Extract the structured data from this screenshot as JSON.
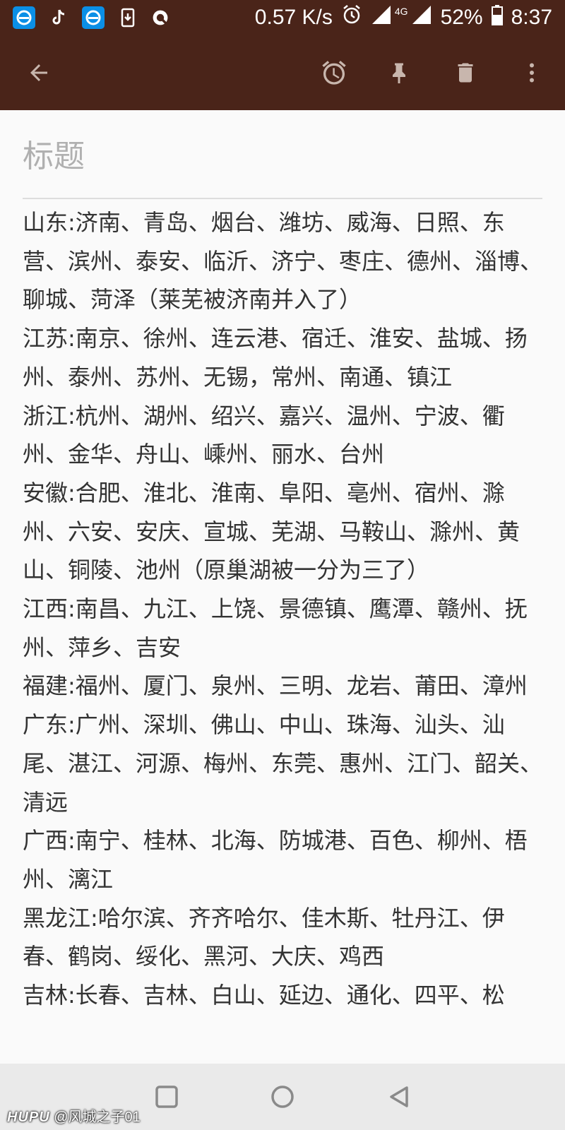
{
  "status_bar": {
    "net_speed": "0.57 K/s",
    "network": "4G",
    "battery": "52%",
    "time": "8:37",
    "icons": [
      "browser-app-icon",
      "tiktok-icon",
      "browser-app-icon",
      "download-icon",
      "q-app-icon",
      "alarm-icon",
      "signal-icon",
      "battery-icon"
    ]
  },
  "toolbar": {
    "icons": [
      "back-arrow-icon",
      "alarm-reminder-icon",
      "pin-icon",
      "delete-icon",
      "more-vert-icon"
    ],
    "color": "#4a2419"
  },
  "note": {
    "title_placeholder": "标题",
    "lines": [
      "山东:济南、青岛、烟台、潍坊、威海、日照、东营、滨州、泰安、临沂、济宁、枣庄、德州、淄博、聊城、菏泽（莱芜被济南并入了）",
      "江苏:南京、徐州、连云港、宿迁、淮安、盐城、扬州、泰州、苏州、无锡，常州、南通、镇江",
      "浙江:杭州、湖州、绍兴、嘉兴、温州、宁波、衢州、金华、舟山、嵊州、丽水、台州",
      "安徽:合肥、淮北、淮南、阜阳、亳州、宿州、滁州、六安、安庆、宣城、芜湖、马鞍山、滁州、黄山、铜陵、池州（原巢湖被一分为三了）",
      "江西:南昌、九江、上饶、景德镇、鹰潭、赣州、抚州、萍乡、吉安",
      "福建:福州、厦门、泉州、三明、龙岩、莆田、漳州",
      "广东:广州、深圳、佛山、中山、珠海、汕头、汕尾、湛江、河源、梅州、东莞、惠州、江门、韶关、清远",
      "广西:南宁、桂林、北海、防城港、百色、柳州、梧州、漓江",
      "黑龙江:哈尔滨、齐齐哈尔、佳木斯、牡丹江、伊春、鹤岗、绥化、黑河、大庆、鸡西",
      "吉林:长春、吉林、白山、延边、通化、四平、松"
    ]
  },
  "nav_bar": {
    "icons": [
      "recents-square-icon",
      "home-circle-icon",
      "back-triangle-icon"
    ]
  },
  "watermark": {
    "brand": "HUPU",
    "user": "@风城之子01"
  }
}
